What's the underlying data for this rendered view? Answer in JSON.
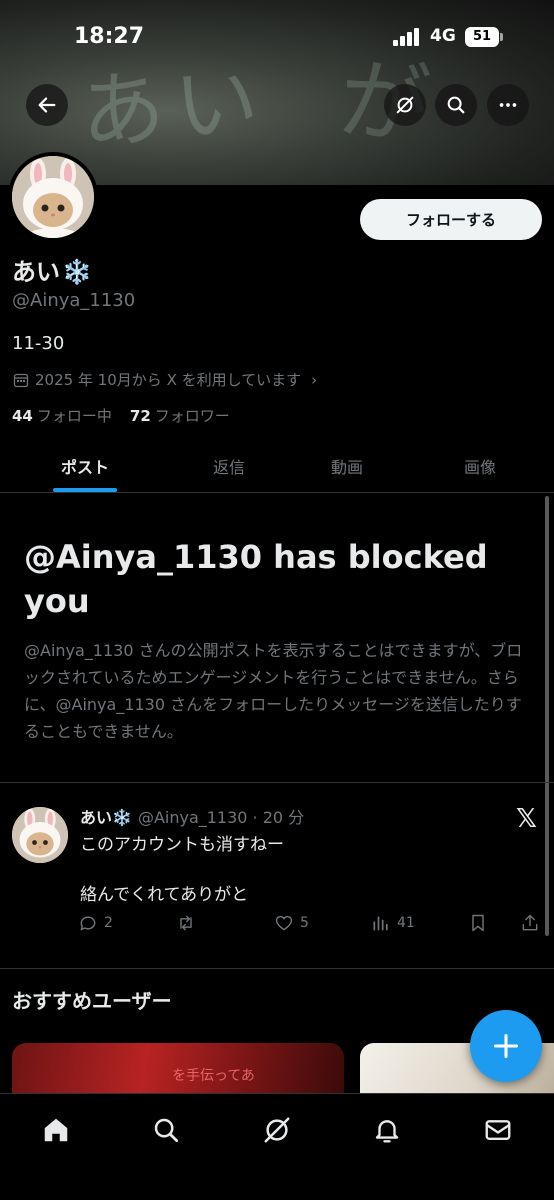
{
  "status_bar": {
    "time": "18:27",
    "network": "4G",
    "battery": "51"
  },
  "header": {
    "back_icon": "back-arrow-icon",
    "grok_icon": "grok-icon",
    "search_icon": "search-icon",
    "more_icon": "more-icon"
  },
  "profile": {
    "name": "あい",
    "name_emoji": "❄️",
    "handle": "@Ainya_1130",
    "bio": "11-30",
    "joined": "2025 年 10月から X を利用しています",
    "following_count": "44",
    "following_label": "フォロー中",
    "followers_count": "72",
    "followers_label": "フォロワー",
    "follow_button": "フォローする"
  },
  "tabs": [
    {
      "label": "ポスト",
      "active": true
    },
    {
      "label": "返信",
      "active": false
    },
    {
      "label": "動画",
      "active": false
    },
    {
      "label": "画像",
      "active": false
    }
  ],
  "blocked": {
    "title": "@Ainya_1130 has blocked you",
    "text": "@Ainya_1130 さんの公開ポストを表示することはできますが、ブロックされているためエンゲージメントを行うことはできません。さらに、@Ainya_1130 さんをフォローしたりメッセージを送信したりすることもできません。"
  },
  "tweet": {
    "name": "あい❄️",
    "meta": "@Ainya_1130 · 20 分",
    "line1": "このアカウントも消すねー",
    "line2": "絡んでくれてありがと",
    "replies": "2",
    "retweets": "",
    "likes": "5",
    "views": "41"
  },
  "recommend": {
    "title": "おすすめユーザー",
    "card1_text": "を手伝ってあ"
  },
  "colors": {
    "accent": "#1d9bf0",
    "background": "#000000",
    "text": "#e7e9ea",
    "muted": "#71767b"
  },
  "nav": [
    "home-icon",
    "search-icon",
    "grok-icon",
    "notifications-icon",
    "messages-icon"
  ]
}
